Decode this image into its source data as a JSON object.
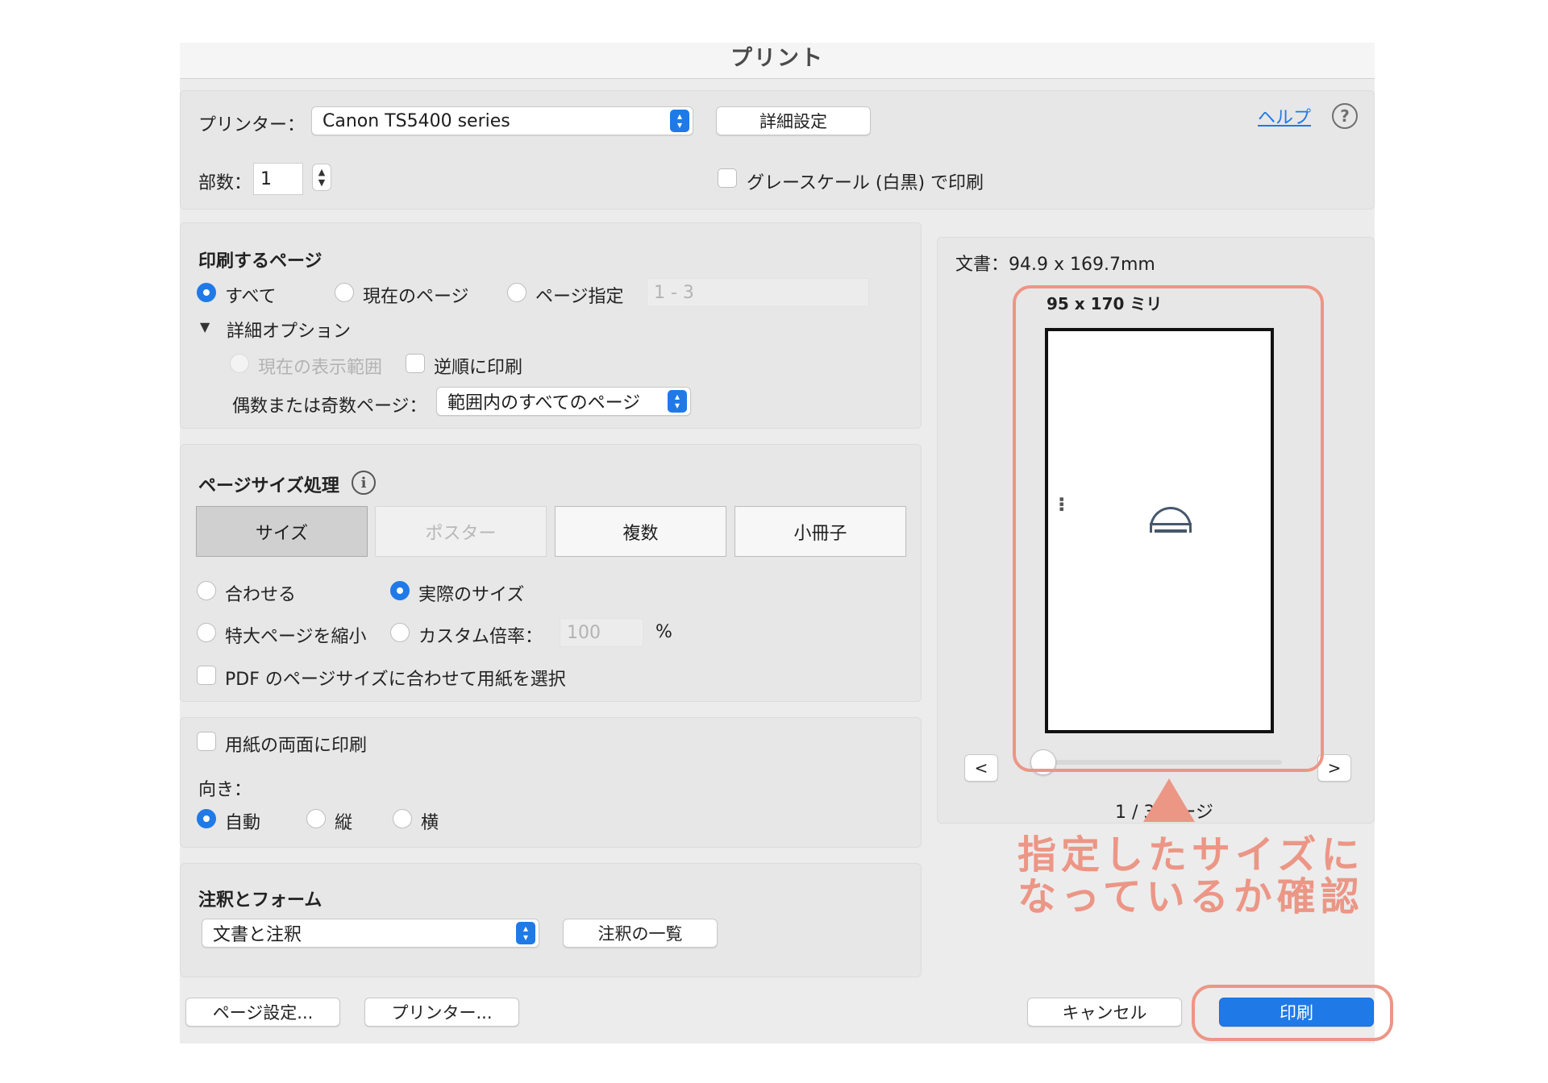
{
  "dialog": {
    "title": "プリント"
  },
  "printer_row": {
    "printer_label": "プリンター：",
    "printer_value": "Canon TS5400 series",
    "details_button": "詳細設定",
    "help_link": "ヘルプ",
    "help_icon_glyph": "?"
  },
  "copies_row": {
    "copies_label": "部数：",
    "copies_value": "1",
    "grayscale_label": "グレースケール (白黒) で印刷"
  },
  "pages_to_print": {
    "heading": "印刷するページ",
    "option_all": "すべて",
    "option_current": "現在のページ",
    "option_range": "ページ指定",
    "range_placeholder": "1 - 3",
    "more_options_toggle": "詳細オプション",
    "current_view_label": "現在の表示範囲",
    "reverse_label": "逆順に印刷",
    "odd_even_label": "偶数または奇数ページ：",
    "odd_even_value": "範囲内のすべてのページ"
  },
  "page_sizing": {
    "heading": "ページサイズ処理",
    "info_glyph": "i",
    "tabs": [
      "サイズ",
      "ポスター",
      "複数",
      "小冊子"
    ],
    "fit_label": "合わせる",
    "actual_size_label": "実際のサイズ",
    "shrink_label": "特大ページを縮小",
    "custom_scale_label": "カスタム倍率：",
    "custom_scale_value": "100",
    "percent_sign": "%",
    "choose_paper_label": "PDF のページサイズに合わせて用紙を選択"
  },
  "duplex": {
    "both_sides_label": "用紙の両面に印刷",
    "orientation_label": "向き：",
    "auto_label": "自動",
    "portrait_label": "縦",
    "landscape_label": "横"
  },
  "annotations": {
    "heading": "注釈とフォーム",
    "value": "文書と注釈",
    "summary_button": "注釈の一覧"
  },
  "footer": {
    "page_setup_button": "ページ設定...",
    "printer_button": "プリンター...",
    "cancel_button": "キャンセル",
    "print_button": "印刷"
  },
  "preview": {
    "doc_size": "文書：94.9 x 169.7mm",
    "paper_size": "95 x 170 ミリ",
    "prev_button": "<",
    "next_button": ">",
    "page_indicator": "1 / 3 ページ"
  },
  "callout": {
    "line1": "指定したサイズに",
    "line2": "なっているか確認"
  },
  "colors": {
    "accent": "#1f7ae8",
    "annotation": "#ec9686",
    "dialog_bg": "#ececec"
  }
}
